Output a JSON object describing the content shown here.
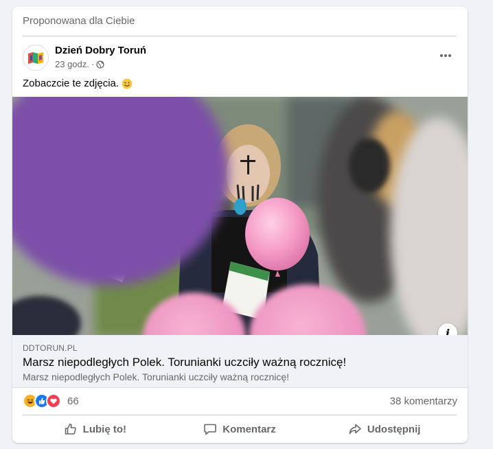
{
  "feed": {
    "suggested_label": "Proponowana dla Ciebie"
  },
  "post": {
    "page_name": "Dzień Dobry Toruń",
    "time": "23 godz.",
    "separator": "·",
    "audience_icon": "globe-icon",
    "more_icon": "ellipsis-icon",
    "text": "Zobaczcie te zdjęcia.",
    "emoji": "slightly-smiling-face"
  },
  "link": {
    "domain": "DDTORUN.PL",
    "title": "Marsz niepodległych Polek. Torunianki uczciły ważną rocznicę!",
    "description": "Marsz niepodległych Polek. Torunianki uczciły ważną rocznicę!",
    "info_label": "i"
  },
  "stats": {
    "reaction_icons": [
      "haha-icon",
      "like-icon",
      "love-icon"
    ],
    "reactions_count": "66",
    "comments": "38 komentarzy"
  },
  "actions": {
    "like": "Lubię to!",
    "comment": "Komentarz",
    "share": "Udostępnij"
  },
  "colors": {
    "accent": "#1877f2",
    "love": "#f33e58",
    "haha": "#f7b125",
    "secondary_text": "#65676b"
  }
}
